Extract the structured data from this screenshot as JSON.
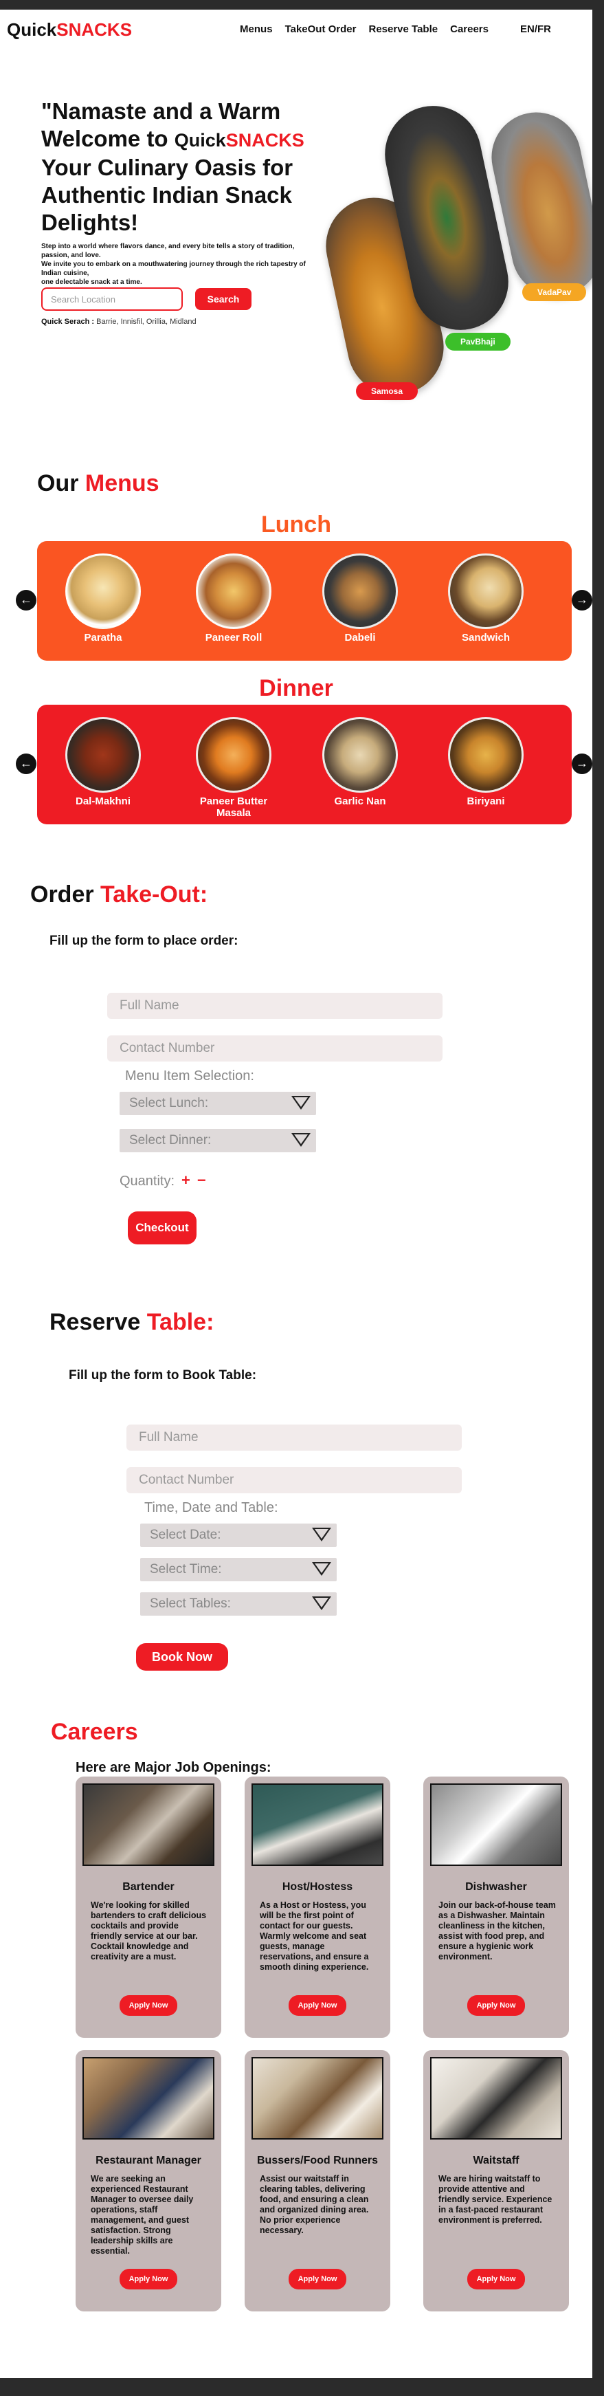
{
  "brand": {
    "prefix": "Quick",
    "accent": "SNACKS"
  },
  "nav": [
    {
      "label": "Menus"
    },
    {
      "label": "TakeOut Order"
    },
    {
      "label": "Reserve Table"
    },
    {
      "label": "Careers"
    },
    {
      "label": "EN/FR"
    }
  ],
  "hero": {
    "title_line1": "\"Namaste and a Warm Welcome to",
    "title_brand_prefix": "Quick",
    "title_brand_accent": "SNACKS",
    "title_line2": "Your Culinary Oasis for Authentic Indian Snack Delights!",
    "desc1": "Step into a world where flavors dance, and every bite tells a story of tradition, passion, and love.",
    "desc2": "We invite you to embark on a mouthwatering journey through the rich tapestry of Indian cuisine,",
    "desc3": "one delectable snack at a time.",
    "search_placeholder": "Search Location",
    "search_button": "Search",
    "quick_search_label": "Quick Serach :",
    "quick_search_values": "Barrie, Innisfil, Orillia, Midland",
    "tags": {
      "samosa": "Samosa",
      "pavbhaji": "PavBhaji",
      "vadapav": "VadaPav"
    }
  },
  "menus": {
    "title_prefix": "Our",
    "title_accent": "Menus",
    "lunch_title": "Lunch",
    "dinner_title": "Dinner",
    "lunch_items": [
      "Paratha",
      "Paneer Roll",
      "Dabeli",
      "Sandwich"
    ],
    "dinner_items": [
      "Dal-Makhni",
      "Paneer Butter Masala",
      "Garlic Nan",
      "Biriyani"
    ]
  },
  "order": {
    "title_prefix": "Order",
    "title_accent": "Take-Out:",
    "heading": "Fill up the form to place order:",
    "full_name_placeholder": "Full Name",
    "contact_placeholder": "Contact Number",
    "menu_selection_label": "Menu Item Selection:",
    "select_lunch": "Select Lunch:",
    "select_dinner": "Select Dinner:",
    "quantity_label": "Quantity:",
    "plus": "+",
    "minus": "−",
    "checkout": "Checkout"
  },
  "reserve": {
    "title_prefix": "Reserve",
    "title_accent": "Table:",
    "heading": "Fill up the form to Book Table:",
    "full_name_placeholder": "Full Name",
    "contact_placeholder": "Contact Number",
    "time_label": "Time, Date and Table:",
    "select_date": "Select Date:",
    "select_time": "Select Time:",
    "select_tables": "Select Tables:",
    "book_now": "Book Now"
  },
  "careers": {
    "title": "Careers",
    "subtitle": "Here are Major Job Openings:",
    "apply_label": "Apply Now",
    "jobs": [
      {
        "title": "Bartender",
        "desc": "We're looking for skilled bartenders to craft delicious cocktails and provide friendly service at our bar. Cocktail knowledge and creativity are a must."
      },
      {
        "title": "Host/Hostess",
        "desc": "As a Host or Hostess, you will be the first point of contact for our guests. Warmly welcome and seat guests, manage reservations, and ensure a smooth dining experience."
      },
      {
        "title": "Dishwasher",
        "desc": "Join our back-of-house team as a Dishwasher. Maintain cleanliness in the kitchen, assist with food prep, and ensure a hygienic work environment."
      },
      {
        "title": "Restaurant Manager",
        "desc": "We are seeking an experienced Restaurant Manager to oversee daily operations, staff management, and guest satisfaction. Strong leadership skills are essential."
      },
      {
        "title": "Bussers/Food Runners",
        "desc": "Assist our waitstaff in clearing tables, delivering food, and ensuring a clean and organized dining area. No prior experience necessary."
      },
      {
        "title": "Waitstaff",
        "desc": "We are hiring waitstaff to provide attentive and friendly service. Experience in a fast-paced restaurant environment is preferred."
      }
    ]
  },
  "colors": {
    "accent": "#ee1c24",
    "lunch_band": "#fa5522",
    "dinner_band": "#ee1c24",
    "card": "#c4b7b7",
    "field": "#f2ebeb"
  },
  "icons": {
    "prev": "arrow-left-icon",
    "next": "arrow-right-icon",
    "dropdown": "triangle-down-icon"
  }
}
